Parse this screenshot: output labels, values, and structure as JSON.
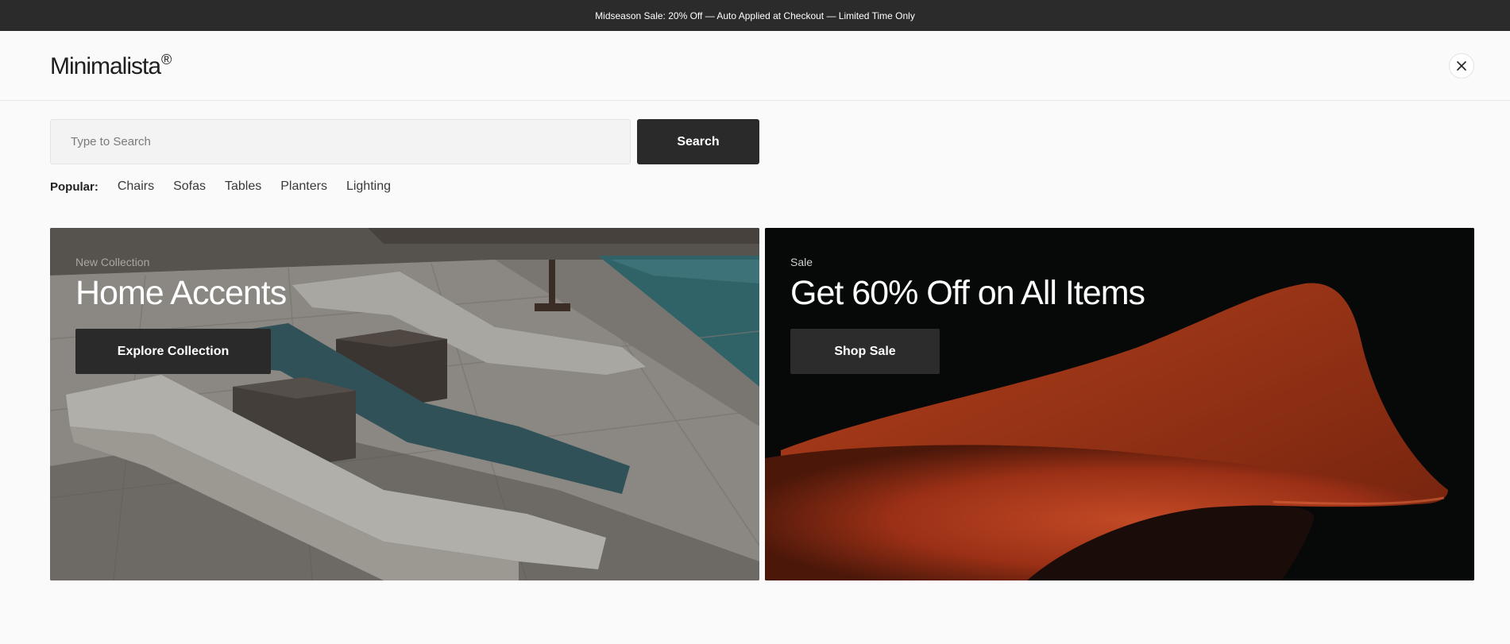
{
  "announcement": "Midseason Sale: 20% Off — Auto Applied at Checkout — Limited Time Only",
  "header": {
    "logo": "Minimalista",
    "logo_mark": "®"
  },
  "search": {
    "placeholder": "Type to Search",
    "value": "",
    "button_label": "Search"
  },
  "popular": {
    "label": "Popular:",
    "links": [
      "Chairs",
      "Sofas",
      "Tables",
      "Planters",
      "Lighting"
    ]
  },
  "cards": [
    {
      "eyebrow": "New Collection",
      "title": "Home Accents",
      "button_label": "Explore Collection"
    },
    {
      "eyebrow": "Sale",
      "title": "Get 60% Off on All Items",
      "button_label": "Shop Sale"
    }
  ],
  "icons": {
    "close": "close-icon"
  },
  "colors": {
    "announce_bg": "#2b2b2b",
    "button_bg": "#2a2a2a",
    "chair_orange": "#c2431f"
  }
}
